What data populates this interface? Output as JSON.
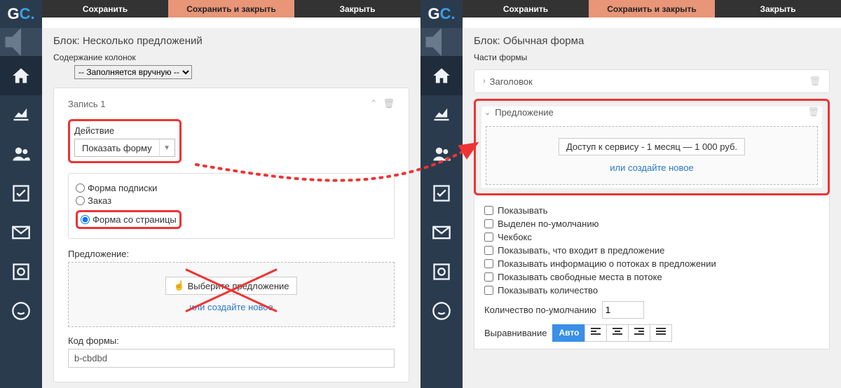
{
  "left": {
    "topbar": [
      "Сохранить",
      "Сохранить и закрыть",
      "Закрыть"
    ],
    "logo": {
      "g": "G",
      "c": "C."
    },
    "title": "Блок: Несколько предложений",
    "subtitle": "Содержание колонок",
    "manual_option": "-- Заполняется вручную --",
    "record": "Запись 1",
    "action_label": "Действие",
    "action_value": "Показать форму",
    "radios": {
      "a": "Форма подписки",
      "b": "Заказ",
      "c": "Форма со страницы"
    },
    "offer_label": "Предложение:",
    "pick_btn": "Выберите предложение",
    "or_new": "или создайте новое",
    "code_label": "Код формы:",
    "code_value": "b-cbdbd"
  },
  "right": {
    "topbar": [
      "Сохранить",
      "Сохранить и закрыть",
      "Закрыть"
    ],
    "logo": {
      "g": "G",
      "c": "C."
    },
    "title": "Блок: Обычная форма",
    "subtitle": "Части формы",
    "row_header": "Заголовок",
    "row_offer": "Предложение",
    "offer_text": "Доступ к сервису - 1 месяц — 1 000 руб.",
    "or_new": "или создайте новое",
    "cb": [
      "Показывать",
      "Выделен по-умолчанию",
      "Чекбокс",
      "Показывать, что входит в предложение",
      "Показывать информацию о потоках в предложении",
      "Показывать свободные места в потоке",
      "Показывать количество"
    ],
    "qty_label": "Количество по-умолчанию",
    "qty_value": "1",
    "align_label": "Выравнивание",
    "align_auto": "Авто"
  }
}
